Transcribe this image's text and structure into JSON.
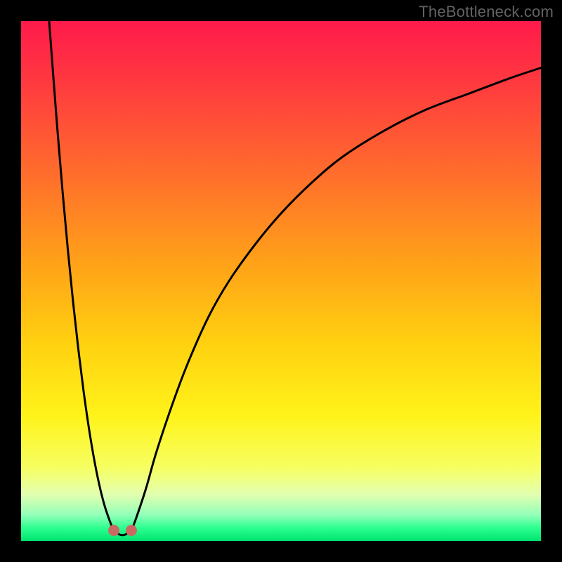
{
  "watermark": "TheBottleneck.com",
  "colors": {
    "frame": "#000000",
    "marker": "#c86a63",
    "curve": "#000000"
  },
  "gradient_stops": [
    {
      "offset": 0.0,
      "color": "#ff1a4b"
    },
    {
      "offset": 0.12,
      "color": "#ff3a3f"
    },
    {
      "offset": 0.3,
      "color": "#ff6f2b"
    },
    {
      "offset": 0.47,
      "color": "#ffa318"
    },
    {
      "offset": 0.62,
      "color": "#ffd110"
    },
    {
      "offset": 0.76,
      "color": "#fff31a"
    },
    {
      "offset": 0.86,
      "color": "#f6ff63"
    },
    {
      "offset": 0.91,
      "color": "#e3ffb0"
    },
    {
      "offset": 0.95,
      "color": "#93ffb8"
    },
    {
      "offset": 0.975,
      "color": "#2cff8f"
    },
    {
      "offset": 1.0,
      "color": "#00e36f"
    }
  ],
  "chart_data": {
    "type": "line",
    "title": "",
    "xlabel": "",
    "ylabel": "",
    "xlim": [
      0,
      100
    ],
    "ylim": [
      0,
      100
    ],
    "grid": false,
    "series": [
      {
        "name": "left-branch",
        "x": [
          5.4,
          6,
          7,
          8,
          9,
          10,
          11,
          12,
          13,
          14,
          15,
          16,
          17,
          17.8
        ],
        "y": [
          100,
          92,
          79,
          67,
          56,
          46,
          37,
          29,
          22,
          16,
          11,
          7,
          4,
          2
        ]
      },
      {
        "name": "right-branch",
        "x": [
          21.2,
          22,
          24,
          26,
          29,
          32,
          36,
          40,
          45,
          50,
          56,
          62,
          70,
          78,
          86,
          94,
          100
        ],
        "y": [
          2,
          4,
          10,
          17,
          26,
          34,
          43,
          50,
          57,
          63,
          69,
          74,
          79,
          83,
          86,
          89,
          91
        ]
      }
    ],
    "markers": [
      {
        "x": 17.8,
        "y": 2.0
      },
      {
        "x": 21.2,
        "y": 2.0
      }
    ],
    "flat_bottom": {
      "x": [
        17.8,
        19,
        20,
        21.2
      ],
      "y": [
        2.0,
        1.2,
        1.2,
        2.0
      ]
    }
  }
}
